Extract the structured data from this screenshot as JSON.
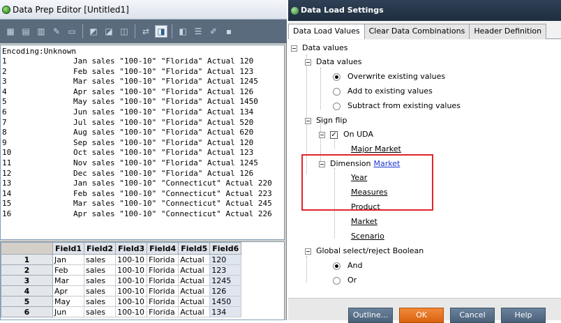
{
  "editor": {
    "title": "Data Prep Editor [Untitled1]",
    "encoding": "Encoding:Unknown",
    "lines": [
      {
        "n": "1",
        "t": "Jan sales \"100-10\" \"Florida\" Actual 120"
      },
      {
        "n": "2",
        "t": "Feb sales \"100-10\" \"Florida\" Actual 123"
      },
      {
        "n": "3",
        "t": "Mar sales \"100-10\" \"Florida\" Actual 1245"
      },
      {
        "n": "4",
        "t": "Apr sales \"100-10\" \"Florida\" Actual 126"
      },
      {
        "n": "5",
        "t": "May sales \"100-10\" \"Florida\" Actual 1450"
      },
      {
        "n": "6",
        "t": "Jun sales \"100-10\" \"Florida\" Actual 134"
      },
      {
        "n": "7",
        "t": "Jul sales \"100-10\" \"Florida\" Actual 520"
      },
      {
        "n": "8",
        "t": "Aug sales \"100-10\" \"Florida\" Actual 620"
      },
      {
        "n": "9",
        "t": "Sep sales \"100-10\" \"Florida\" Actual 120"
      },
      {
        "n": "10",
        "t": "Oct sales \"100-10\" \"Florida\" Actual 123"
      },
      {
        "n": "11",
        "t": "Nov sales \"100-10\" \"Florida\" Actual 1245"
      },
      {
        "n": "12",
        "t": "Dec sales \"100-10\" \"Florida\" Actual 126"
      },
      {
        "n": "13",
        "t": "Jan sales \"100-10\" \"Connecticut\" Actual 220"
      },
      {
        "n": "14",
        "t": "Feb sales \"100-10\" \"Connecticut\" Actual 223"
      },
      {
        "n": "15",
        "t": "Mar sales \"100-10\" \"Connecticut\" Actual 245"
      },
      {
        "n": "16",
        "t": "Apr sales \"100-10\" \"Connecticut\" Actual 226"
      }
    ],
    "toolbar_icons": [
      "open-icon",
      "save-icon",
      "filter-icon",
      "tools-icon",
      "view-icon",
      "split-icon",
      "join-icon",
      "move-icon",
      "replace-icon",
      "active-load-settings-icon",
      "dimension-icon",
      "properties-icon",
      "field-edit-icon",
      "more-icon"
    ],
    "grid": {
      "headers": [
        "Field1",
        "Field2",
        "Field3",
        "Field4",
        "Field5",
        "Field6"
      ],
      "rows": [
        {
          "num": "1",
          "cells": [
            "Jan",
            "sales",
            "100-10",
            "Florida",
            "Actual",
            "120"
          ]
        },
        {
          "num": "2",
          "cells": [
            "Feb",
            "sales",
            "100-10",
            "Florida",
            "Actual",
            "123"
          ]
        },
        {
          "num": "3",
          "cells": [
            "Mar",
            "sales",
            "100-10",
            "Florida",
            "Actual",
            "1245"
          ]
        },
        {
          "num": "4",
          "cells": [
            "Apr",
            "sales",
            "100-10",
            "Florida",
            "Actual",
            "126"
          ]
        },
        {
          "num": "5",
          "cells": [
            "May",
            "sales",
            "100-10",
            "Florida",
            "Actual",
            "1450"
          ]
        },
        {
          "num": "6",
          "cells": [
            "Jun",
            "sales",
            "100-10",
            "Florida",
            "Actual",
            "134"
          ]
        }
      ]
    }
  },
  "dialog": {
    "title": "Data Load Settings",
    "tabs": [
      "Data Load Values",
      "Clear Data Combinations",
      "Header Definition"
    ],
    "tree": {
      "data_values_root": "Data values",
      "data_values": "Data values",
      "overwrite": "Overwrite existing values",
      "add": "Add to existing values",
      "subtract": "Subtract from existing values",
      "sign_flip": "Sign flip",
      "on_uda": "On UDA",
      "major_market": "Major Market",
      "dimension": "Dimension",
      "dimension_value": "Market",
      "dims": [
        "Year",
        "Measures",
        "Product",
        "Market",
        "Scenario"
      ],
      "global": "Global select/reject Boolean",
      "and": "And",
      "or": "Or"
    },
    "buttons": {
      "outline": "Outline...",
      "ok": "OK",
      "cancel": "Cancel",
      "help": "Help"
    },
    "highlight_color": "#e0242a"
  }
}
